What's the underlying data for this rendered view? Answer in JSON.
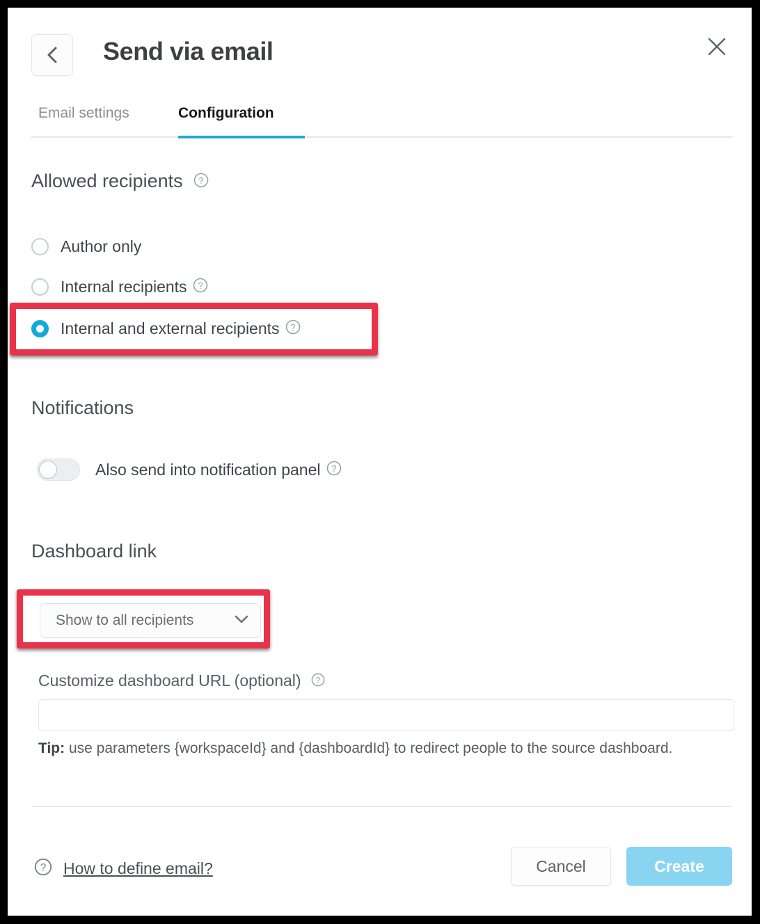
{
  "header": {
    "title": "Send via email",
    "back_icon": "chevron-left-icon",
    "close_icon": "close-icon"
  },
  "tabs": [
    {
      "label": "Email settings",
      "active": false
    },
    {
      "label": "Configuration",
      "active": true
    }
  ],
  "sections": {
    "allowed_recipients": {
      "title": "Allowed recipients",
      "help_icon": "help-circle-icon",
      "options": [
        {
          "label": "Author only",
          "selected": false,
          "help": false
        },
        {
          "label": "Internal recipients",
          "selected": false,
          "help": true
        },
        {
          "label": "Internal and external recipients",
          "selected": true,
          "help": true
        }
      ]
    },
    "notifications": {
      "title": "Notifications",
      "toggle_label": "Also send into notification panel",
      "toggle_on": false,
      "help_icon": "help-circle-icon"
    },
    "dashboard_link": {
      "title": "Dashboard link",
      "dropdown_value": "Show to all recipients",
      "dropdown_icon": "chevron-down-icon",
      "url_label": "Customize dashboard URL (optional)",
      "url_value": "",
      "url_placeholder": "",
      "tip_prefix": "Tip:",
      "tip_text": " use parameters {workspaceId} and {dashboardId} to redirect people to the source dashboard."
    }
  },
  "footer": {
    "help_icon": "help-circle-icon",
    "help_link": "How to define email?",
    "cancel_label": "Cancel",
    "create_label": "Create"
  },
  "colors": {
    "accent": "#23a8d8",
    "radio_selected": "#12a9dd",
    "annotation": "#e8334a",
    "create_button": "#89d5f1",
    "title_text": "#3c4043",
    "body_text": "#3f454b",
    "muted_text": "#8a9096"
  }
}
